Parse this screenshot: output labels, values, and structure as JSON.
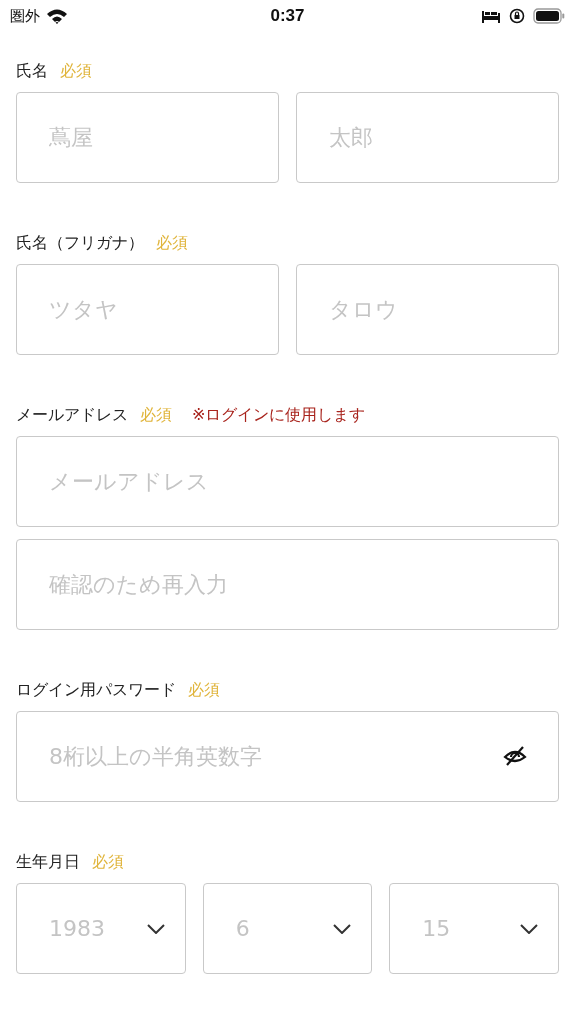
{
  "status_bar": {
    "carrier": "圏外",
    "time": "0:37"
  },
  "sections": [
    {
      "label": "氏名",
      "required": "必須",
      "fields": [
        {
          "kind": "text",
          "placeholder": "蔦屋"
        },
        {
          "kind": "text",
          "placeholder": "太郎"
        }
      ]
    },
    {
      "label": "氏名（フリガナ）",
      "required": "必須",
      "fields": [
        {
          "kind": "text",
          "placeholder": "ツタヤ"
        },
        {
          "kind": "text",
          "placeholder": "タロウ"
        }
      ]
    },
    {
      "label": "メールアドレス",
      "required": "必須",
      "note": "※ログインに使用します",
      "fields": [
        {
          "kind": "text",
          "placeholder": "メールアドレス"
        }
      ]
    },
    {
      "fields": [
        {
          "kind": "text",
          "placeholder": "確認のため再入力"
        }
      ]
    },
    {
      "label": "ログイン用パスワード",
      "required": "必須",
      "fields": [
        {
          "kind": "password",
          "placeholder": "8桁以上の半角英数字"
        }
      ]
    },
    {
      "label": "生年月日",
      "required": "必須",
      "fields": [
        {
          "kind": "select",
          "placeholder": "1983"
        },
        {
          "kind": "select",
          "placeholder": "6"
        },
        {
          "kind": "select",
          "placeholder": "15"
        }
      ]
    }
  ]
}
